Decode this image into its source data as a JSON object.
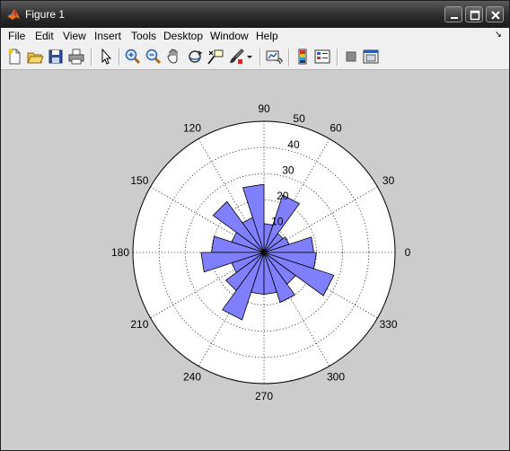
{
  "window": {
    "title": "Figure 1",
    "controls": [
      "minimize",
      "maximize",
      "close"
    ]
  },
  "menubar": {
    "items": [
      "File",
      "Edit",
      "View",
      "Insert",
      "Tools",
      "Desktop",
      "Window",
      "Help"
    ]
  },
  "toolbar": {
    "buttons": [
      "new-figure",
      "open-file",
      "save-figure",
      "print-figure",
      "edit-plot",
      "zoom-in",
      "zoom-out",
      "pan",
      "rotate-3d",
      "data-cursor",
      "brush",
      "brush-dropdown",
      "link-plot",
      "insert-colorbar",
      "insert-legend",
      "hide-plot-tools",
      "show-plot-tools"
    ]
  },
  "chart_data": {
    "type": "rose",
    "title": "",
    "angle_unit": "degrees",
    "angle_ticks": [
      0,
      30,
      60,
      90,
      120,
      150,
      180,
      210,
      240,
      270,
      300,
      330
    ],
    "angle_tick_labels": [
      "0",
      "30",
      "60",
      "90",
      "120",
      "150",
      "180",
      "210",
      "240",
      "270",
      "300",
      "330"
    ],
    "radial_ticks": [
      10,
      20,
      30,
      40,
      50
    ],
    "radial_tick_labels": [
      "10",
      "20",
      "30",
      "40",
      "50"
    ],
    "rmax": 50,
    "grid": true,
    "bin_width_deg": 18,
    "bins": [
      {
        "start": 0,
        "end": 18,
        "value": 19
      },
      {
        "start": 18,
        "end": 36,
        "value": 10
      },
      {
        "start": 36,
        "end": 54,
        "value": 9
      },
      {
        "start": 54,
        "end": 72,
        "value": 23
      },
      {
        "start": 72,
        "end": 90,
        "value": 11
      },
      {
        "start": 90,
        "end": 108,
        "value": 26
      },
      {
        "start": 108,
        "end": 126,
        "value": 14
      },
      {
        "start": 126,
        "end": 144,
        "value": 24
      },
      {
        "start": 144,
        "end": 162,
        "value": 13
      },
      {
        "start": 162,
        "end": 180,
        "value": 20
      },
      {
        "start": 180,
        "end": 198,
        "value": 24
      },
      {
        "start": 198,
        "end": 216,
        "value": 13
      },
      {
        "start": 216,
        "end": 234,
        "value": 18
      },
      {
        "start": 234,
        "end": 252,
        "value": 27
      },
      {
        "start": 252,
        "end": 270,
        "value": 16
      },
      {
        "start": 270,
        "end": 288,
        "value": 16
      },
      {
        "start": 288,
        "end": 306,
        "value": 20
      },
      {
        "start": 306,
        "end": 324,
        "value": 15
      },
      {
        "start": 324,
        "end": 342,
        "value": 28
      },
      {
        "start": 342,
        "end": 360,
        "value": 20
      }
    ],
    "fill_color": "#7f7fff",
    "edge_color": "#000000"
  }
}
